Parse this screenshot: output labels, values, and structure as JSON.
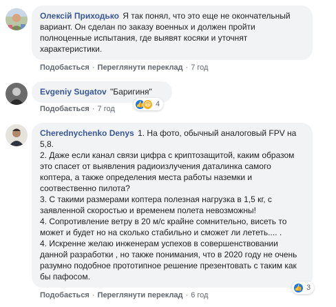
{
  "comments": [
    {
      "author": "Олексій Приходько",
      "text": "Я так понял, что это еще не окончательный вариант. Он сделан по заказу военных и должен пройти полноценные испытания, где выявят косяки и уточнят характеристики.",
      "like": "Подобається",
      "translate": "Переглянути переклад",
      "time": "7 год"
    },
    {
      "author": "Evgeniy Sugatov",
      "text": "\"Баригиня\"",
      "like": "Подобається",
      "time": "7 год",
      "reaction_count": "4",
      "reactions": [
        "like-reaction-icon",
        "haha-reaction-icon"
      ]
    },
    {
      "author": "Cherednychenko Denys",
      "lines": [
        "1. На фото, обычный аналоговый FPV на 5,8.",
        "2. Даже если канал связи цифра с криптозащитой, каким образом это спасет от выявления радиоизлучения даталинка самого коптера, а также определения места работы наземки и соотвественно пилота?",
        "3. С такими размерами коптера полезная нагрузка в 1,5 кг, с заявленной скоростью и временем полета невозможны!",
        "4. Сопротивление ветру в 20 м/с крайне сомнительно, висеть то может и будет но на сколько стабильно и сможет ли лететь.... .",
        "4. Искренне желаю инженерам успехов в совершенствовании данной разработки , но также понимания, что в 2020 году не очень разумно подобное прототипное решение презентовать с таким как бы пафосом."
      ],
      "like": "Подобається",
      "translate": "Переглянути переклад",
      "time": "6 год",
      "reaction_count": "3",
      "reactions": [
        "like-reaction-icon"
      ]
    }
  ],
  "colors": {
    "author": "#385898",
    "bubble": "#f2f3f5",
    "meta": "#606770",
    "like": "#1877f2",
    "haha": "#f7b125"
  }
}
